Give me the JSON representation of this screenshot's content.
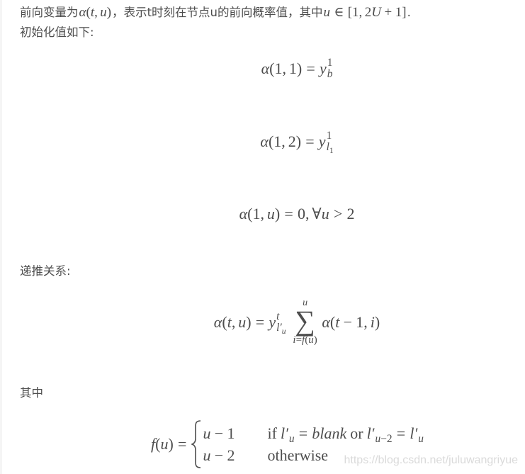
{
  "page": {
    "background": "#ffffff",
    "text_color": "#4d4d4d",
    "watermark_color": "#dadada"
  },
  "intro": {
    "line1": {
      "text_a": "前向变量为",
      "math_a": [
        "α",
        "(",
        "t",
        ",",
        "u",
        ")"
      ],
      "text_b": "，表示t时刻在节点u的前向概率值，其中",
      "math_b": [
        "u",
        "∈",
        "[",
        "1",
        ",",
        "2",
        "U",
        "+",
        "1",
        "]"
      ],
      "text_c": "."
    },
    "line2": "初始化值如下:"
  },
  "init_equations": [
    {
      "lhs": [
        "α",
        "(",
        "1",
        ",",
        "1",
        ")"
      ],
      "eq": "=",
      "base": "y",
      "sup": "1",
      "sub": "b"
    },
    {
      "lhs": [
        "α",
        "(",
        "1",
        ",",
        "2",
        ")"
      ],
      "eq": "=",
      "base": "y",
      "sup": "1",
      "sub": "l",
      "subsub": "1"
    },
    {
      "lhs": [
        "α",
        "(",
        "1",
        ",",
        "u",
        ")"
      ],
      "eq": "=",
      "rhs": [
        "0",
        ",",
        "∀",
        "u",
        ">",
        "2"
      ]
    }
  ],
  "recursion": {
    "heading": "递推关系:",
    "equation": {
      "lhs": [
        "α",
        "(",
        "t",
        ",",
        "u",
        ")"
      ],
      "eq": "=",
      "base": "y",
      "sup": "t",
      "sub": "l′",
      "subsub": "u",
      "sum": {
        "symbol": "∑",
        "upper": "u",
        "lower": [
          "i",
          "=",
          "f",
          "(",
          "u",
          ")"
        ]
      },
      "term": [
        "α",
        "(",
        "t",
        "−",
        "1",
        ",",
        "i",
        ")"
      ]
    }
  },
  "where": {
    "heading": "其中",
    "equation": {
      "lhs": [
        "f",
        "(",
        "u",
        ")"
      ],
      "eq": "=",
      "cases": [
        {
          "value": [
            "u",
            "−",
            "1"
          ],
          "condition": {
            "if": "if",
            "l1": "l′",
            "l1_sub": "u",
            "eq1": "=",
            "blank": "blank",
            "or": "or",
            "l2": "l′",
            "l2_sub": [
              "u",
              "−",
              "2"
            ],
            "eq2": "=",
            "l3": "l′",
            "l3_sub": "u"
          }
        },
        {
          "value": [
            "u",
            "−",
            "2"
          ],
          "condition_text": "otherwise"
        }
      ]
    }
  },
  "watermark": "https://blog.csdn.net/juluwangriyue"
}
